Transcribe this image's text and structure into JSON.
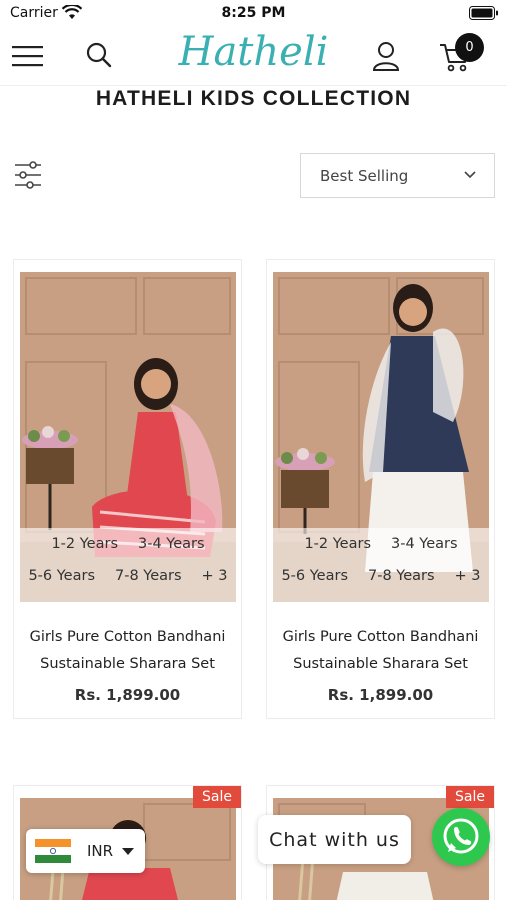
{
  "status_bar": {
    "carrier": "Carrier",
    "time": "8:25 PM"
  },
  "header": {
    "logo": "Hatheli",
    "cart_count": "0"
  },
  "page": {
    "title": "HATHELI KIDS COLLECTION"
  },
  "toolbar": {
    "sort_selected": "Best Selling"
  },
  "products": [
    {
      "title_line1": "Girls Pure Cotton Bandhani",
      "title_line2": "Sustainable Sharara Set",
      "price": "Rs. 1,899.00",
      "sizes_row1": [
        "1-2 Years",
        "3-4 Years"
      ],
      "sizes_row2": [
        "5-6 Years",
        "7-8 Years",
        "+ 3"
      ],
      "outfit_color": "#e0474f"
    },
    {
      "title_line1": "Girls Pure Cotton Bandhani",
      "title_line2": "Sustainable Sharara Set",
      "price": "Rs. 1,899.00",
      "sizes_row1": [
        "1-2 Years",
        "3-4 Years"
      ],
      "sizes_row2": [
        "5-6 Years",
        "7-8 Years",
        "+ 3"
      ],
      "outfit_color": "#2e3a57"
    },
    {
      "badge": "Sale",
      "outfit_color": "#e0474f"
    },
    {
      "badge": "Sale",
      "outfit_color": "#f1eee8"
    }
  ],
  "floating": {
    "currency": "INR",
    "chat": "Chat with us"
  },
  "colors": {
    "accent": "#3bb0b3",
    "sale": "#e24b3b",
    "whatsapp": "#2fc84f"
  }
}
